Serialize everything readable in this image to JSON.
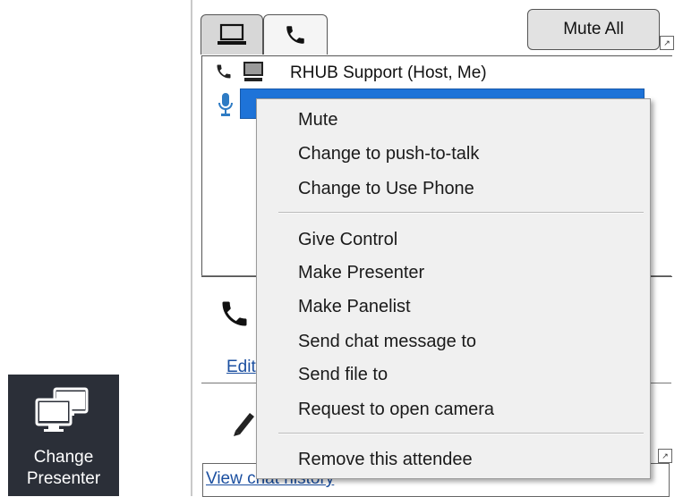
{
  "presenter_tile": {
    "label_line1": "Change",
    "label_line2": "Presenter",
    "icon": "monitors-icon"
  },
  "tabs": [
    {
      "name": "computer",
      "icon": "laptop-icon",
      "active": true
    },
    {
      "name": "phone",
      "icon": "phone-icon",
      "active": false
    }
  ],
  "toolbar": {
    "mute_all_label": "Mute All"
  },
  "attendees": {
    "host_name": "RHUB Support (Host, Me)"
  },
  "context_menu": {
    "group1": [
      "Mute",
      "Change to push-to-talk",
      "Change to Use Phone"
    ],
    "group2": [
      "Give Control",
      "Make Presenter",
      "Make Panelist",
      "Send chat message to",
      "Send file to",
      "Request to open camera"
    ],
    "group3": [
      "Remove this attendee"
    ]
  },
  "links": {
    "edit_partial": "Edit",
    "view_chat_history": "View chat history"
  },
  "colors": {
    "selection_blue": "#1e73d8",
    "tile_dark": "#2b2f38",
    "link_blue": "#1b4fa0",
    "mic_blue": "#2e7bc4"
  }
}
